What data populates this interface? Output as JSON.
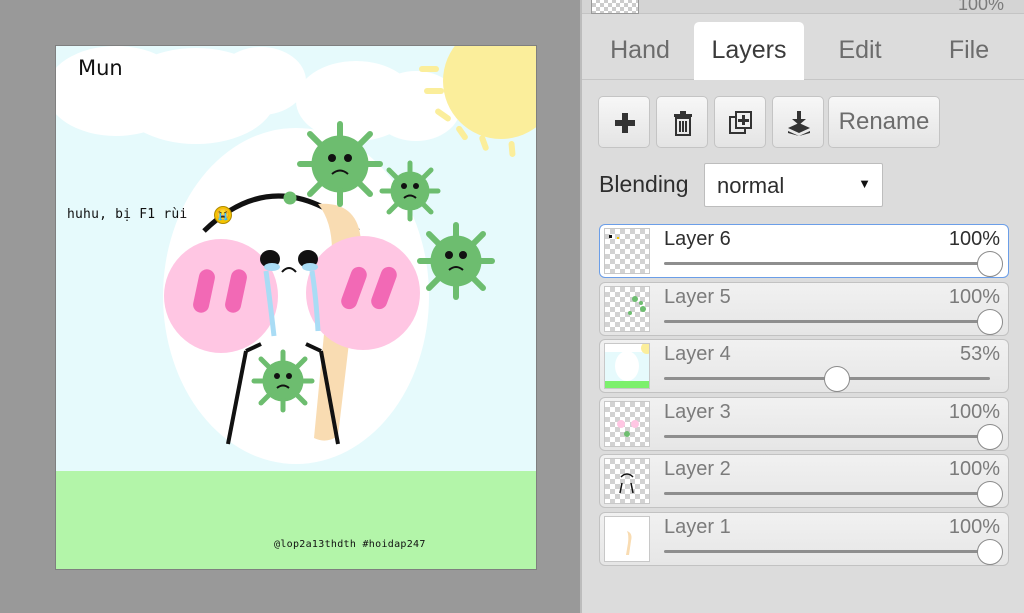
{
  "panel": {
    "top_layer_opacity": "100%",
    "tabs": [
      {
        "label": "Hand",
        "active": false
      },
      {
        "label": "Layers",
        "active": true
      },
      {
        "label": "Edit",
        "active": false
      },
      {
        "label": "File",
        "active": false
      }
    ],
    "toolbar": {
      "icons": [
        "plus-icon",
        "trash-icon",
        "duplicate-icon",
        "merge-down-icon"
      ],
      "rename_label": "Rename"
    },
    "blending": {
      "label": "Blending",
      "value": "normal"
    },
    "layers": [
      {
        "name": "Layer 6",
        "opacity_label": "100%",
        "opacity": 1.0,
        "selected": true
      },
      {
        "name": "Layer 5",
        "opacity_label": "100%",
        "opacity": 1.0,
        "selected": false
      },
      {
        "name": "Layer 4",
        "opacity_label": "53%",
        "opacity": 0.53,
        "selected": false
      },
      {
        "name": "Layer 3",
        "opacity_label": "100%",
        "opacity": 1.0,
        "selected": false
      },
      {
        "name": "Layer 2",
        "opacity_label": "100%",
        "opacity": 1.0,
        "selected": false
      },
      {
        "name": "Layer 1",
        "opacity_label": "100%",
        "opacity": 1.0,
        "selected": false
      }
    ]
  },
  "artwork": {
    "title": "Mun",
    "caption": "huhu, bị F1 rùi",
    "credits": "@lop2a13thdth  #hoidap247"
  },
  "colors": {
    "accent_selected": "#6b9ee8",
    "canvas_bg": "#e6fafc",
    "grass": "#b3f5a9",
    "virus": "#6dbd6f",
    "blush": "#ffc6e3"
  }
}
